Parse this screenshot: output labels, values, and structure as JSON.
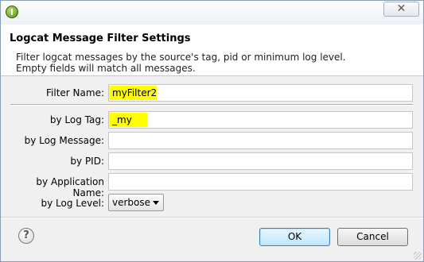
{
  "window": {
    "close_glyph": "✕"
  },
  "dialog": {
    "title": "Logcat Message Filter Settings",
    "description_line1": "Filter logcat messages by the source's tag, pid or minimum log level.",
    "description_line2": "Empty fields will match all messages."
  },
  "form": {
    "filter_name_label": "Filter Name:",
    "filter_name_value": "myFilter2",
    "log_tag_label": "by Log Tag:",
    "log_tag_value": "_my",
    "log_message_label": "by Log Message:",
    "log_message_value": "",
    "pid_label": "by PID:",
    "pid_value": "",
    "app_name_label": "by Application Name:",
    "app_name_value": "",
    "log_level_label": "by Log Level:",
    "log_level_value": "verbose"
  },
  "footer": {
    "help_glyph": "?",
    "ok_label": "OK",
    "cancel_label": "Cancel"
  }
}
